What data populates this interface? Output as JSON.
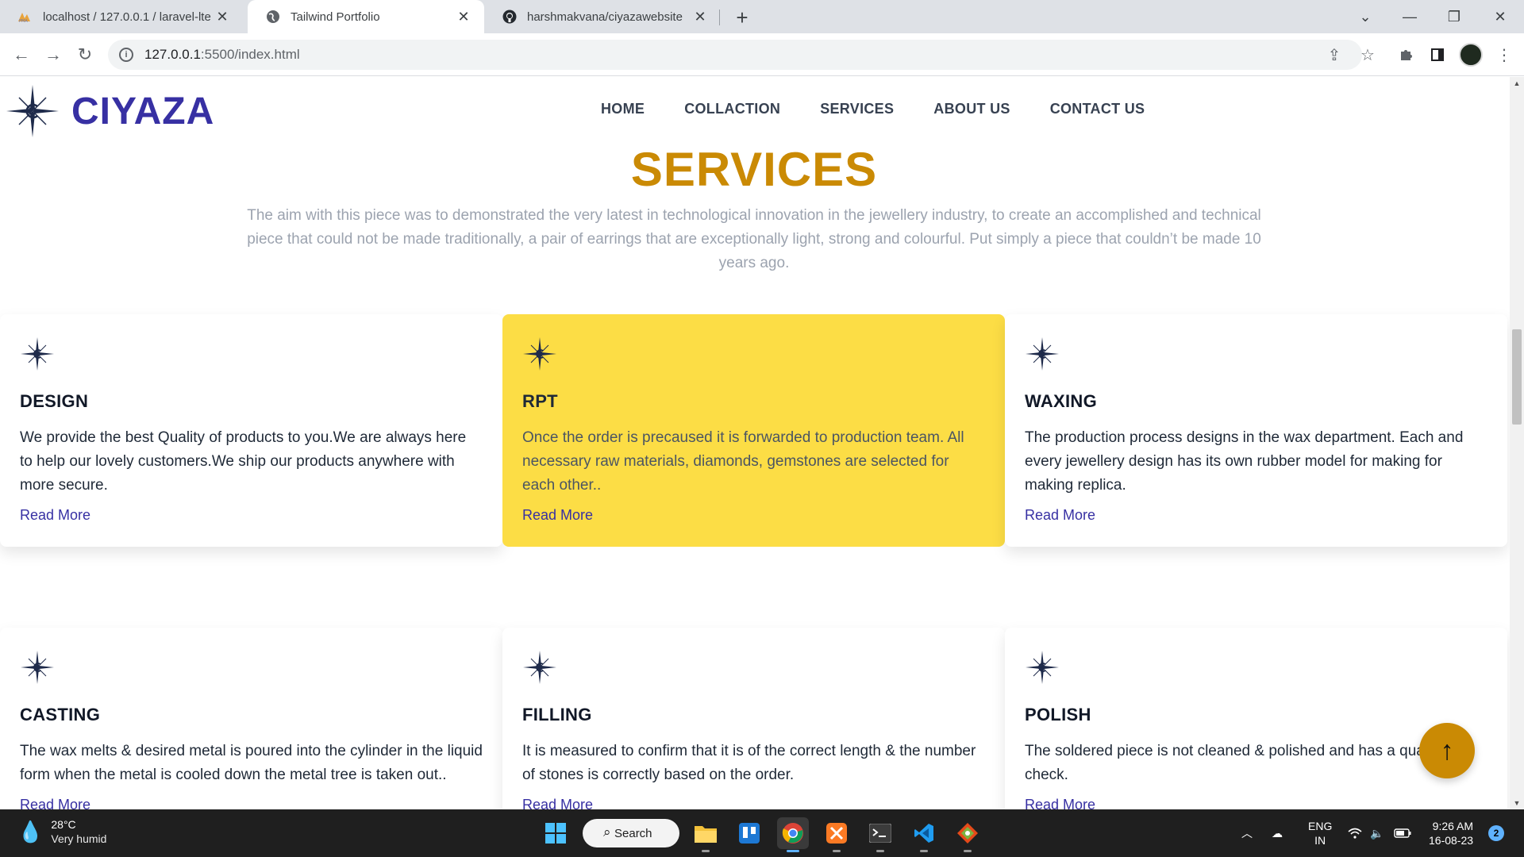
{
  "browser": {
    "tabs": [
      {
        "title": "localhost / 127.0.0.1 / laravel-lte",
        "favicon": "phpmyadmin-icon",
        "active": false
      },
      {
        "title": "Tailwind Portfolio",
        "favicon": "globe-icon",
        "active": true
      },
      {
        "title": "harshmakvana/ciyazawebsite",
        "favicon": "github-icon",
        "active": false
      }
    ],
    "url_host": "127.0.0.1",
    "url_rest": ":5500/index.html"
  },
  "site": {
    "logo_text": "CIYAZA",
    "nav": [
      "HOME",
      "COLLACTION",
      "SERVICES",
      "ABOUT US",
      "CONTACT US"
    ]
  },
  "services": {
    "title": "SERVICES",
    "description": "The aim with this piece was to demonstrated the very latest in technological innovation in the jewellery industry, to create an accomplished and technical piece that could not be made traditionally, a pair of earrings that are exceptionally light, strong and colourful. Put simply a piece that couldn’t be made 10 years ago.",
    "cards": [
      {
        "title": "DESIGN",
        "text": "We provide the best Quality of products to you.We are always here to help our lovely customers.We ship our products anywhere with more secure.",
        "link": "Read More"
      },
      {
        "title": "RPT",
        "text": "Once the order is precaused it is forwarded to production team. All necessary raw materials, diamonds, gemstones are selected for each other..",
        "link": "Read More"
      },
      {
        "title": "WAXING",
        "text": "The production process designs in the wax department. Each and every jewellery design has its own rubber model for making for making replica.",
        "link": "Read More"
      },
      {
        "title": "CASTING",
        "text": "The wax melts & desired metal is poured into the cylinder in the liquid form when the metal is cooled down the metal tree is taken out..",
        "link": "Read More"
      },
      {
        "title": "FILLING",
        "text": "It is measured to confirm that it is of the correct length & the number of stones is correctly based on the order.",
        "link": "Read More"
      },
      {
        "title": "POLISH",
        "text": "The soldered piece is not cleaned & polished and has a quality check.",
        "link": "Read More"
      }
    ]
  },
  "scroll_top_symbol": "↑",
  "taskbar": {
    "weather_temp": "28°C",
    "weather_desc": "Very humid",
    "search_label": "Search",
    "lang_line1": "ENG",
    "lang_line2": "IN",
    "time": "9:26 AM",
    "date": "16-08-23",
    "notification_count": "2"
  },
  "colors": {
    "brand": "#3730a3",
    "accent": "#ca8a04",
    "highlight_card": "#fcdd45"
  }
}
